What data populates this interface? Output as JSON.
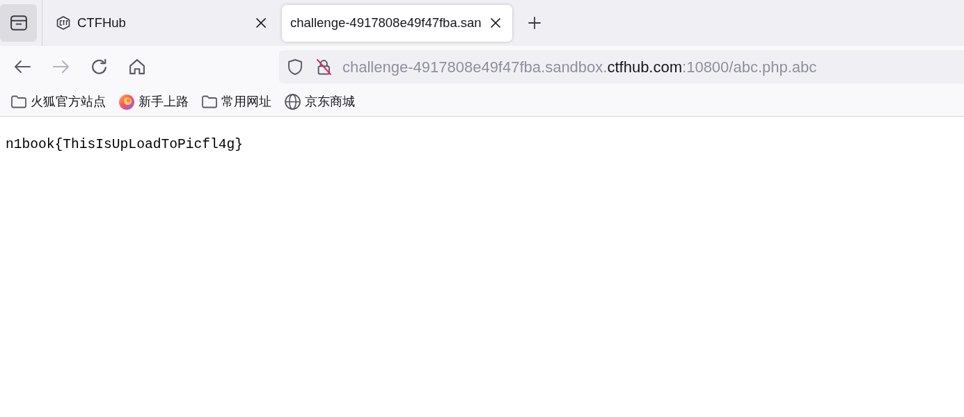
{
  "tabs": [
    {
      "kind": "favicon",
      "title": "CTFHub",
      "selected": false
    },
    {
      "kind": "plain",
      "title": "challenge-4917808e49f47fba.san",
      "selected": true
    }
  ],
  "toolbar": {
    "nav_buttons": [
      {
        "kind": "back",
        "disabled": false
      },
      {
        "kind": "forward",
        "disabled": true
      },
      {
        "kind": "reload",
        "disabled": false
      },
      {
        "kind": "home",
        "disabled": false
      }
    ],
    "address_bar": {
      "insecure": true,
      "url": "challenge-4917808e49f47fba.sandbox.**ctfhub.com**:10800/abc.php.abc"
    }
  },
  "bookmarks": [
    {
      "kind": "folder",
      "label": "火狐官方站点"
    },
    {
      "kind": "logo",
      "label": "新手上路"
    },
    {
      "kind": "folder",
      "label": "常用网址"
    },
    {
      "kind": "globe",
      "label": "京东商城"
    }
  ],
  "page": {
    "text": "n1book{ThisIsUpLoadToPicfl4g}"
  }
}
